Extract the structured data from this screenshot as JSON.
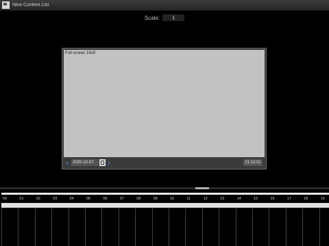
{
  "window": {
    "title": "New Content List",
    "icon": "app-window-icon"
  },
  "scale": {
    "label": "Scale:",
    "value": "1"
  },
  "preview": {
    "canvas_label": "Full screen 16x9",
    "date": "2020-10-07",
    "time": "21:13:31",
    "icons": {
      "prev": "chevron-left-icon",
      "next": "chevron-right-icon",
      "calendar": "calendar-icon"
    },
    "colors": {
      "canvas": "#c2c2c2",
      "nav_arrow": "#4d8be0"
    }
  },
  "timeline": {
    "hours": [
      "00",
      "01",
      "02",
      "03",
      "04",
      "05",
      "06",
      "07",
      "08",
      "09",
      "10",
      "11",
      "12",
      "13",
      "14",
      "15",
      "16",
      "17",
      "18",
      "19"
    ]
  }
}
